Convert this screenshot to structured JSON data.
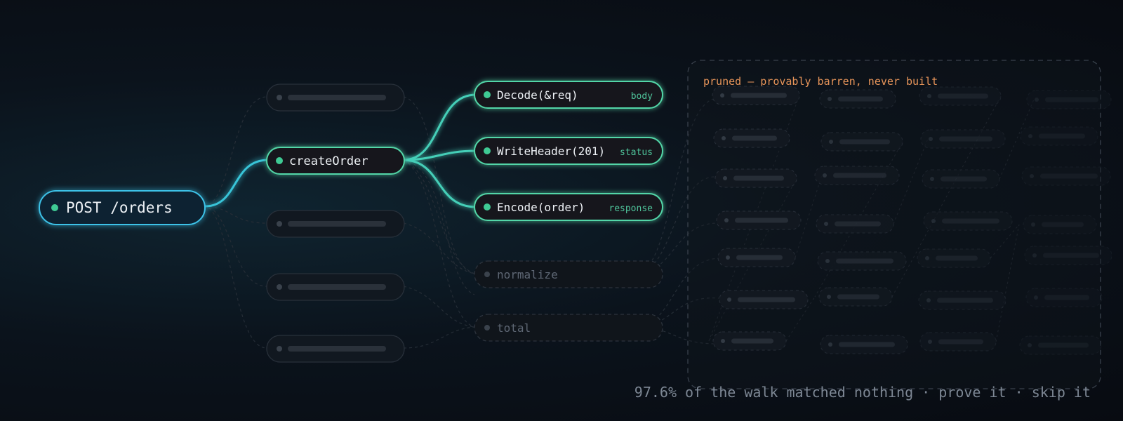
{
  "root": {
    "label": "POST /orders"
  },
  "handler": {
    "label": "createOrder"
  },
  "calls": [
    {
      "label": "Decode(&req)",
      "tag": "body"
    },
    {
      "label": "WriteHeader(201)",
      "tag": "status"
    },
    {
      "label": "Encode(order)",
      "tag": "response"
    }
  ],
  "unmatched": [
    {
      "label": "normalize"
    },
    {
      "label": "total"
    }
  ],
  "pruned": {
    "title": "pruned — provably barren, never built"
  },
  "caption": "97.6% of the walk matched nothing · prove it · skip it",
  "colors": {
    "root_stroke": "#3ec2e8",
    "match_stroke": "#52d6a8",
    "dot": "#3fca94",
    "tag": "#4fc49b",
    "ghost_stroke": "#2a323c",
    "pruned_text": "#e8955a"
  }
}
